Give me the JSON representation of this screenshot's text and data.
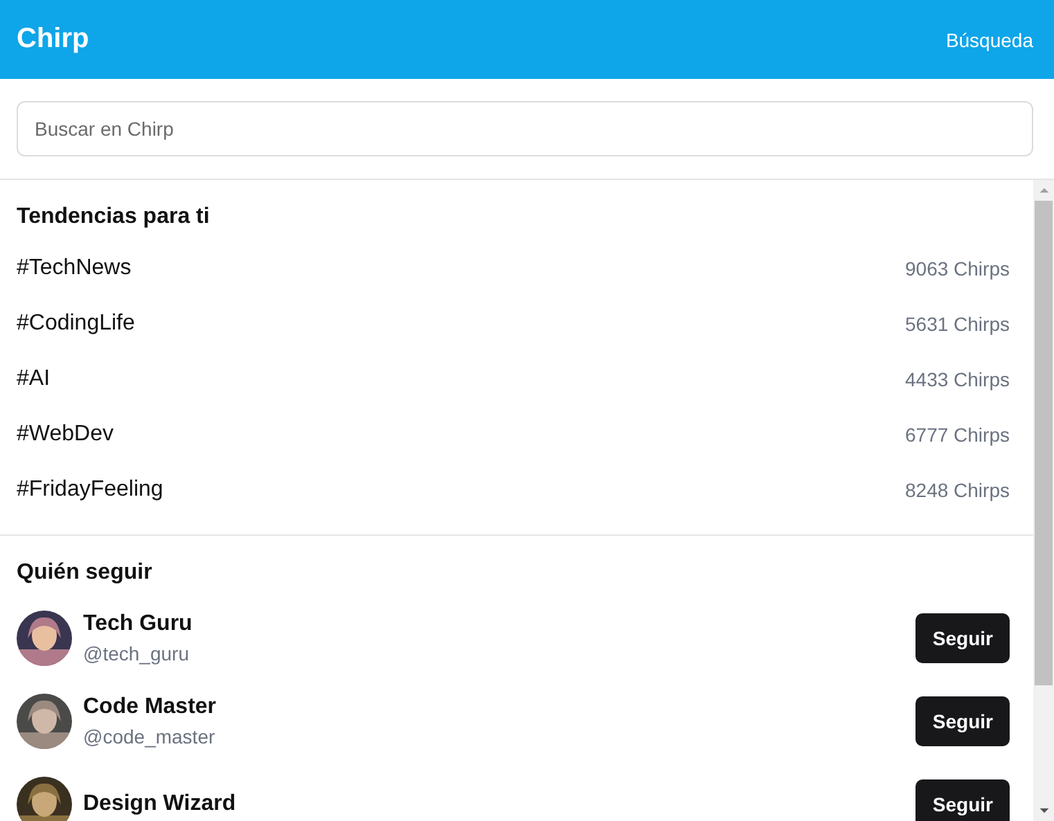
{
  "header": {
    "title": "Chirp",
    "link": "Búsqueda"
  },
  "search": {
    "placeholder": "Buscar en Chirp"
  },
  "trends": {
    "title": "Tendencias para ti",
    "items": [
      {
        "tag": "#TechNews",
        "count": "9063 Chirps"
      },
      {
        "tag": "#CodingLife",
        "count": "5631 Chirps"
      },
      {
        "tag": "#AI",
        "count": "4433 Chirps"
      },
      {
        "tag": "#WebDev",
        "count": "6777 Chirps"
      },
      {
        "tag": "#FridayFeeling",
        "count": "8248 Chirps"
      }
    ]
  },
  "follow": {
    "title": "Quién seguir",
    "users": [
      {
        "name": "Tech Guru",
        "handle": "@tech_guru",
        "button": "Seguir"
      },
      {
        "name": "Code Master",
        "handle": "@code_master",
        "button": "Seguir"
      },
      {
        "name": "Design Wizard",
        "button": "Seguir"
      }
    ]
  }
}
